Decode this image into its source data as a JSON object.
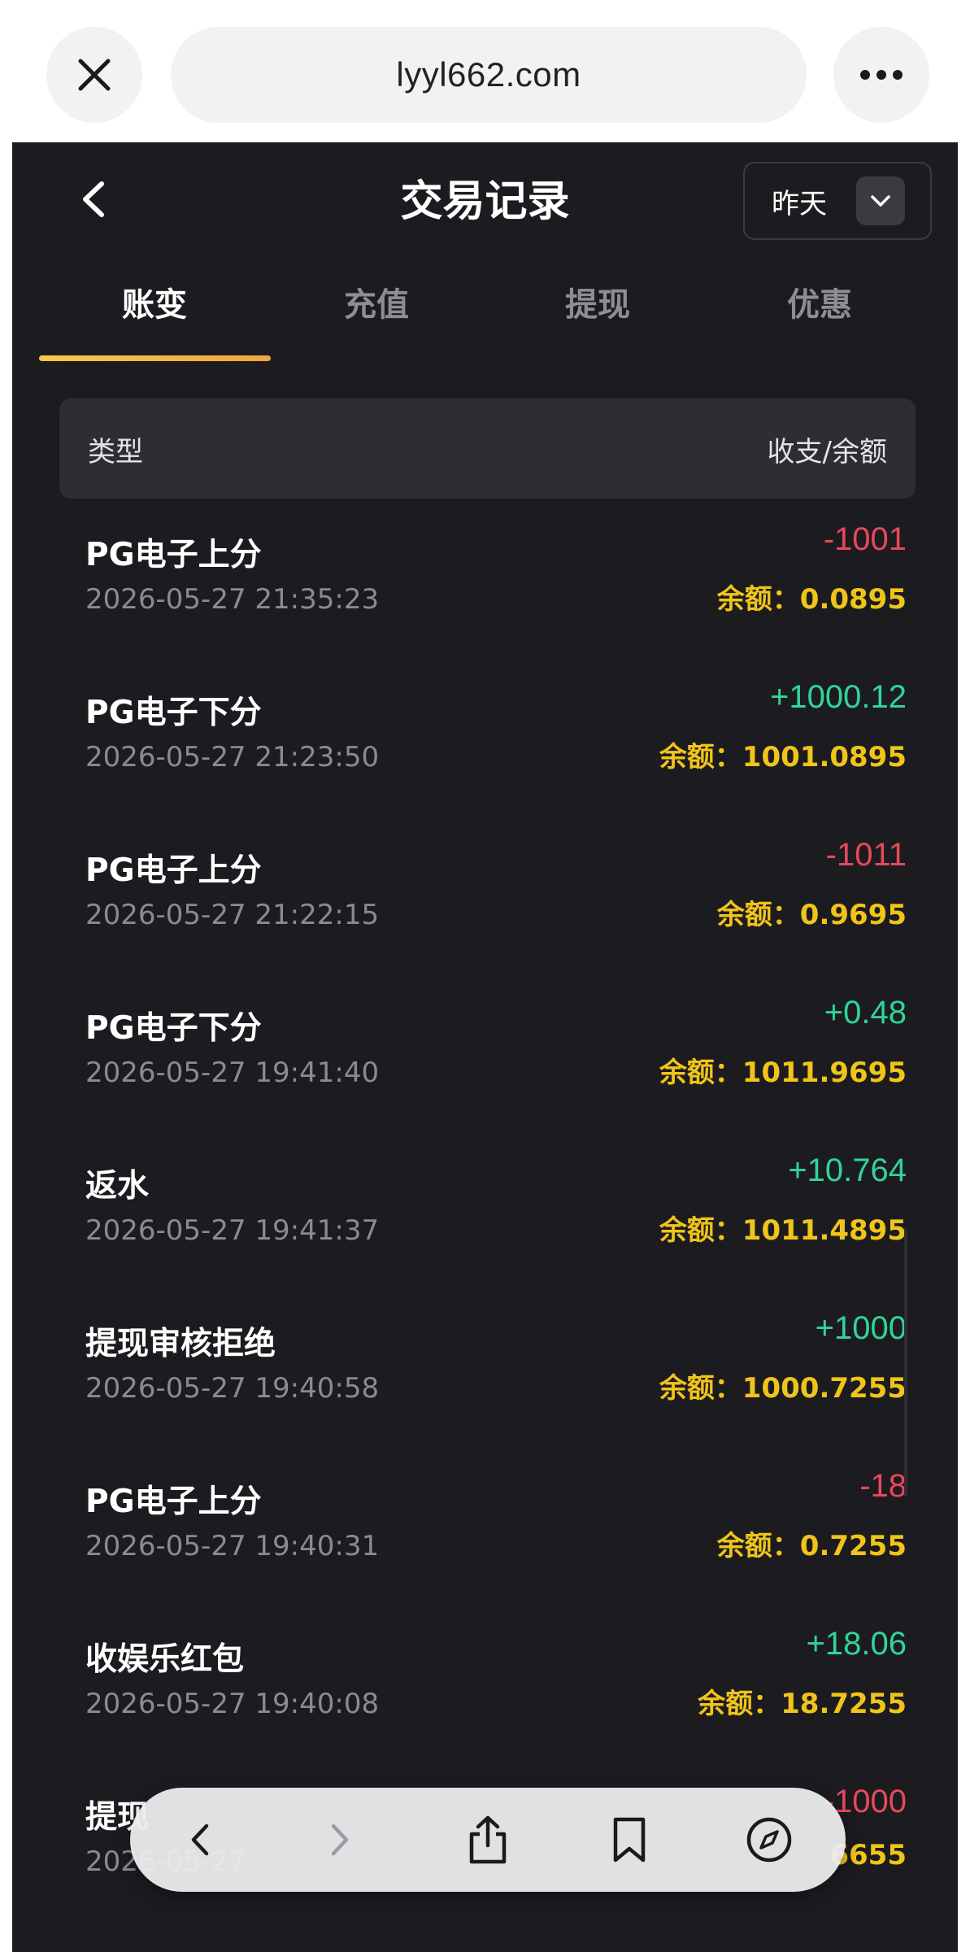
{
  "browser": {
    "url": "lyyl662.com",
    "toolbar_icons": [
      "back-icon",
      "forward-icon",
      "share-icon",
      "bookmark-icon",
      "compass-icon"
    ]
  },
  "header": {
    "title": "交易记录",
    "date_filter": "昨天"
  },
  "tabs": [
    {
      "label": "账变",
      "active": true
    },
    {
      "label": "充值",
      "active": false
    },
    {
      "label": "提现",
      "active": false
    },
    {
      "label": "优惠",
      "active": false
    }
  ],
  "table": {
    "col_type": "类型",
    "col_amount": "收支/余额"
  },
  "records": [
    {
      "type": "PG电子上分",
      "time": "2026-05-27 21:35:23",
      "amount": "-1001",
      "sign": "neg",
      "balance": "余额：0.0895"
    },
    {
      "type": "PG电子下分",
      "time": "2026-05-27 21:23:50",
      "amount": "+1000.12",
      "sign": "pos",
      "balance": "余额：1001.0895"
    },
    {
      "type": "PG电子上分",
      "time": "2026-05-27 21:22:15",
      "amount": "-1011",
      "sign": "neg",
      "balance": "余额：0.9695"
    },
    {
      "type": "PG电子下分",
      "time": "2026-05-27 19:41:40",
      "amount": "+0.48",
      "sign": "pos",
      "balance": "余额：1011.9695"
    },
    {
      "type": "返水",
      "time": "2026-05-27 19:41:37",
      "amount": "+10.764",
      "sign": "pos",
      "balance": "余额：1011.4895"
    },
    {
      "type": "提现审核拒绝",
      "time": "2026-05-27 19:40:58",
      "amount": "+1000",
      "sign": "pos",
      "balance": "余额：1000.7255"
    },
    {
      "type": "PG电子上分",
      "time": "2026-05-27 19:40:31",
      "amount": "-18",
      "sign": "neg",
      "balance": "余额：0.7255"
    },
    {
      "type": "收娱乐红包",
      "time": "2026-05-27 19:40:08",
      "amount": "+18.06",
      "sign": "pos",
      "balance": "余额：18.7255"
    },
    {
      "type": "提现",
      "time": "2026-05-27",
      "amount": "-1000",
      "sign": "neg",
      "balance": "6655"
    }
  ],
  "colors": {
    "background": "#1c1c20",
    "negative": "#e8485d",
    "positive": "#2fd59a",
    "balance": "#f0c419",
    "accent": "#f7c948"
  }
}
